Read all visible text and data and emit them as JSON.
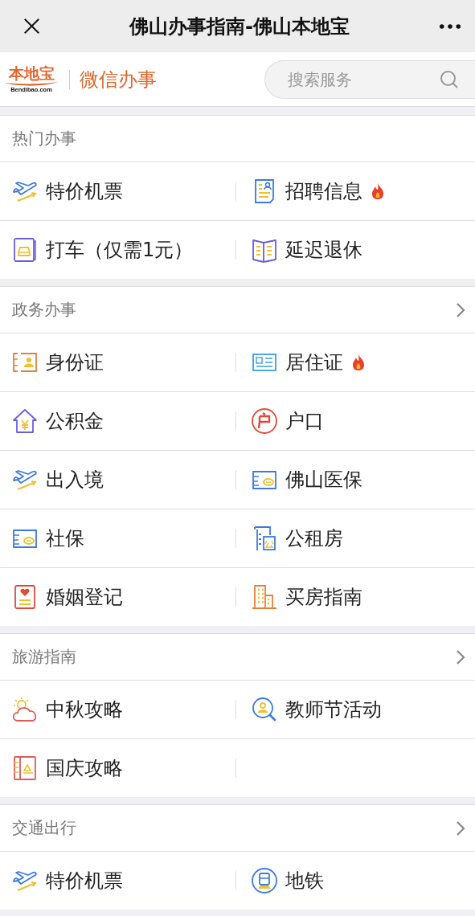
{
  "window": {
    "title": "佛山办事指南-佛山本地宝"
  },
  "header": {
    "logo_text": "本地宝",
    "logo_domain": "Bendibao.com",
    "brand": "微信办事",
    "search": {
      "placeholder": "搜索服务"
    }
  },
  "sections": [
    {
      "title": "热门办事",
      "has_more": false,
      "items": [
        {
          "label": "特价机票",
          "hot": false
        },
        {
          "label": "招聘信息",
          "hot": true
        },
        {
          "label": "打车（仅需1元）",
          "hot": false
        },
        {
          "label": "延迟退休",
          "hot": false
        }
      ]
    },
    {
      "title": "政务办事",
      "has_more": true,
      "items": [
        {
          "label": "身份证",
          "hot": false
        },
        {
          "label": "居住证",
          "hot": true
        },
        {
          "label": "公积金",
          "hot": false
        },
        {
          "label": "户口",
          "hot": false
        },
        {
          "label": "出入境",
          "hot": false
        },
        {
          "label": "佛山医保",
          "hot": false
        },
        {
          "label": "社保",
          "hot": false
        },
        {
          "label": "公租房",
          "hot": false
        },
        {
          "label": "婚姻登记",
          "hot": false
        },
        {
          "label": "买房指南",
          "hot": false
        }
      ]
    },
    {
      "title": "旅游指南",
      "has_more": true,
      "items": [
        {
          "label": "中秋攻略",
          "hot": false
        },
        {
          "label": "教师节活动",
          "hot": false
        },
        {
          "label": "国庆攻略",
          "hot": false
        }
      ]
    },
    {
      "title": "交通出行",
      "has_more": true,
      "items": [
        {
          "label": "特价机票",
          "hot": false
        },
        {
          "label": "地铁",
          "hot": false
        }
      ]
    }
  ]
}
